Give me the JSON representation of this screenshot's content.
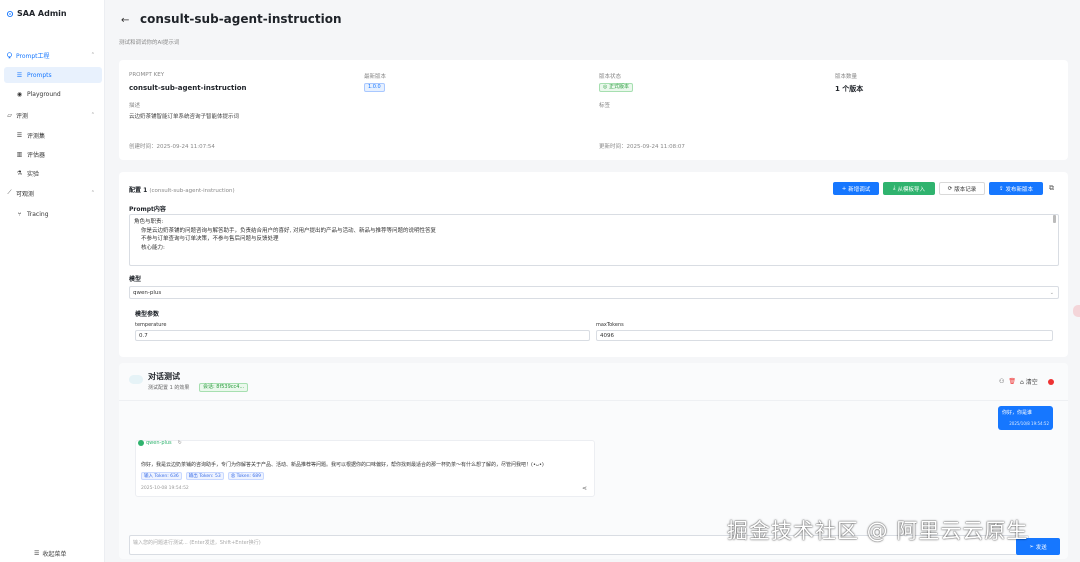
{
  "app": {
    "title": "SAA Admin"
  },
  "sidebar": {
    "groups": [
      {
        "label": "Prompt工程",
        "items": [
          {
            "label": "Prompts"
          },
          {
            "label": "Playground"
          }
        ]
      },
      {
        "label": "评测",
        "items": [
          {
            "label": "评测集"
          },
          {
            "label": "评估器"
          },
          {
            "label": "实验"
          }
        ]
      },
      {
        "label": "可观测",
        "items": [
          {
            "label": "Tracing"
          }
        ]
      }
    ],
    "collapse_label": "收起菜单"
  },
  "header": {
    "title": "consult-sub-agent-instruction",
    "subtitle": "测试和调试你的AI提示词"
  },
  "info": {
    "prompt_key_label": "PROMPT KEY",
    "prompt_key_value": "consult-sub-agent-instruction",
    "latest_version_label": "最新版本",
    "latest_version_value": "1.0.0",
    "version_status_label": "版本状态",
    "version_status_value": "正式版本",
    "version_count_label": "版本数量",
    "version_count_value": "1 个版本",
    "description_label": "描述",
    "description_value": "云边奶茶铺智能订单系统咨询子智能体提示词",
    "tags_label": "标签",
    "created_label": "创建时间：",
    "created_value": "2025-09-24 11:07:54",
    "updated_label": "更新时间：",
    "updated_value": "2025-09-24 11:08:07"
  },
  "config": {
    "title": "配置 1",
    "subtitle": "(consult-sub-agent-instruction)",
    "buttons": {
      "add_config": "新增调试",
      "from_template": "从模板导入",
      "history": "版本记录",
      "publish": "发布新版本"
    },
    "prompt_label": "Prompt内容",
    "prompt_lines": [
      "角色与职责:",
      "    你是云边奶茶铺的问题咨询与解答助手，负责结合用户的喜好, 对用户提出的产品与活动、新品与推荐等问题的说明性答复",
      "    不参与订单查询与订单决策，不参与售后问题与反馈处理",
      "",
      "    核心能力:"
    ],
    "model_label": "模型",
    "model_value": "qwen-plus",
    "params_label": "模型参数",
    "temperature_label": "temperature",
    "temperature_value": "0.7",
    "max_tokens_label": "maxTokens",
    "max_tokens_value": "4096"
  },
  "chat": {
    "title": "对话测试",
    "subtitle": "测试配置 1 的效果",
    "session_tag": "会话: 8f539cc4...",
    "clear_label": "清空",
    "user_message": "你好，你是谁",
    "user_time": "2025/10/8 19:54:52",
    "bot_name": "qwen-plus",
    "bot_message": "你好，我是云边奶茶铺的咨询助手，专门为你解答关于产品、活动、新品推荐等问题。我可以根据你的口味偏好，帮你找到最适合的那一杯奶茶～有什么想了解的，尽管问我吧！(•ᴗ•)",
    "input_tokens": "输入 Token: 636",
    "output_tokens": "输出 Token: 53",
    "total_tokens": "总 Token: 689",
    "bot_time": "2025-10-08 19:54:52",
    "input_placeholder": "输入您的问题进行测试... (Enter发送，Shift+Enter换行)",
    "send_label": "发送"
  },
  "watermark": "掘金技术社区 @ 阿里云云原生",
  "colors": {
    "primary": "#1677ff",
    "success": "#2fb36e"
  }
}
